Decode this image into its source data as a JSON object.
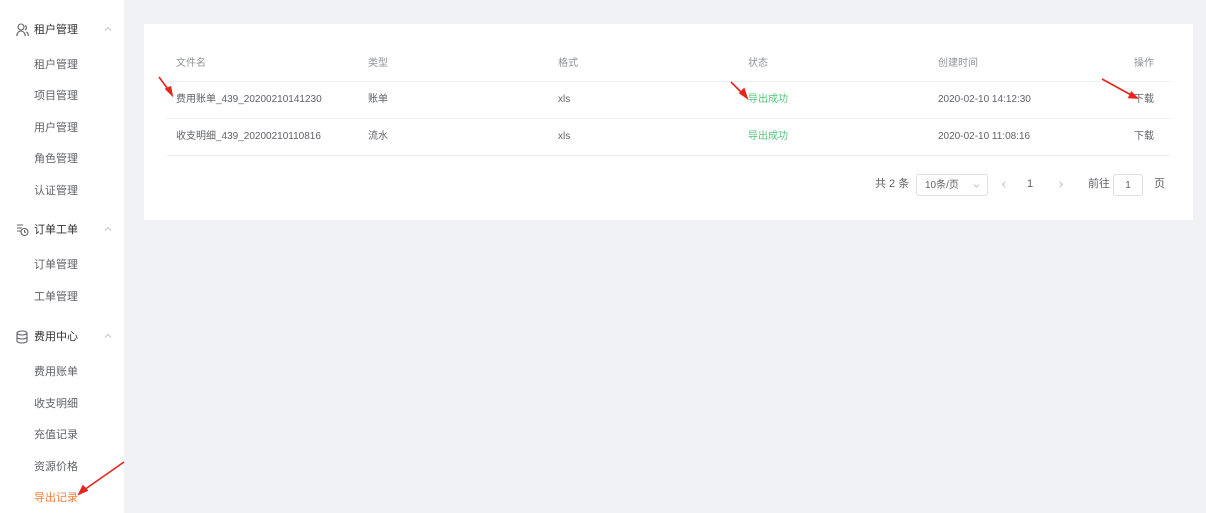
{
  "sidebar": {
    "groups": [
      {
        "label": "租户管理",
        "icon": "user-group-icon",
        "items": [
          "租户管理",
          "项目管理",
          "用户管理",
          "角色管理",
          "认证管理"
        ]
      },
      {
        "label": "订单工单",
        "icon": "order-icon",
        "items": [
          "订单管理",
          "工单管理"
        ]
      },
      {
        "label": "费用中心",
        "icon": "database-icon",
        "items": [
          "费用账单",
          "收支明细",
          "充值记录",
          "资源价格",
          "导出记录"
        ]
      }
    ],
    "active_item": "导出记录"
  },
  "table": {
    "columns": [
      "文件名",
      "类型",
      "格式",
      "状态",
      "创建时间",
      "操作"
    ],
    "rows": [
      {
        "file": "费用账单_439_20200210141230",
        "type": "账单",
        "format": "xls",
        "status": "导出成功",
        "created": "2020-02-10 14:12:30",
        "action": "下载"
      },
      {
        "file": "收支明细_439_20200210110816",
        "type": "流水",
        "format": "xls",
        "status": "导出成功",
        "created": "2020-02-10 11:08:16",
        "action": "下载"
      }
    ]
  },
  "pagination": {
    "total": "共 2 条",
    "page_size": "10条/页",
    "current_page": "1",
    "goto_label": "前往",
    "goto_value": "1",
    "page_unit": "页"
  },
  "colors": {
    "accent": "#f5813a",
    "success": "#55c47a",
    "annotation_arrow": "#e8241c"
  }
}
